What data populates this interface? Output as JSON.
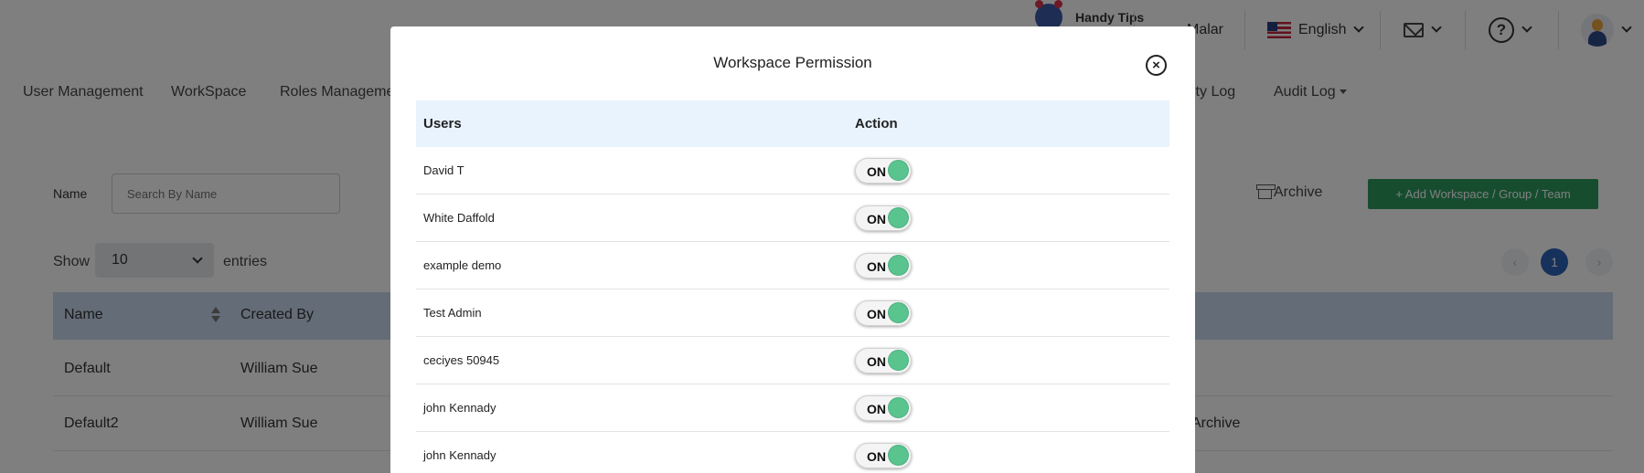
{
  "topbar": {
    "handy_tips": "Handy Tips",
    "user": "Malar",
    "language": "English"
  },
  "nav": {
    "items": [
      "User Management",
      "WorkSpace",
      "Roles Managemen",
      "ity Log",
      "Audit Log"
    ]
  },
  "filter": {
    "name_label": "Name",
    "search_placeholder": "Search By Name",
    "archive_label": "Archive",
    "add_button": "+ Add Workspace / Group / Team"
  },
  "paging": {
    "show_label": "Show",
    "entries_value": "10",
    "entries_label": "entries",
    "prev": "‹",
    "page": "1",
    "next": "›"
  },
  "table": {
    "headers": [
      "Name",
      "Created By"
    ],
    "rows": [
      {
        "name": "Default",
        "created_by": "William Sue",
        "action": ""
      },
      {
        "name": "Default2",
        "created_by": "William Sue",
        "action": "Archive"
      }
    ]
  },
  "modal": {
    "title": "Workspace Permission",
    "close": "×",
    "columns": {
      "users": "Users",
      "action": "Action"
    },
    "rows": [
      {
        "user": "David T",
        "toggle": "ON"
      },
      {
        "user": "White Daffold",
        "toggle": "ON"
      },
      {
        "user": "example demo",
        "toggle": "ON"
      },
      {
        "user": "Test Admin",
        "toggle": "ON"
      },
      {
        "user": "ceciyes 50945",
        "toggle": "ON"
      },
      {
        "user": "john Kennady",
        "toggle": "ON"
      },
      {
        "user": "john Kennady",
        "toggle": "ON"
      }
    ]
  },
  "colors": {
    "accent_green": "#2e9a5e",
    "toggle_on": "#5ac48f",
    "table_head": "#e8f3fd",
    "page_active": "#2c63b8"
  }
}
